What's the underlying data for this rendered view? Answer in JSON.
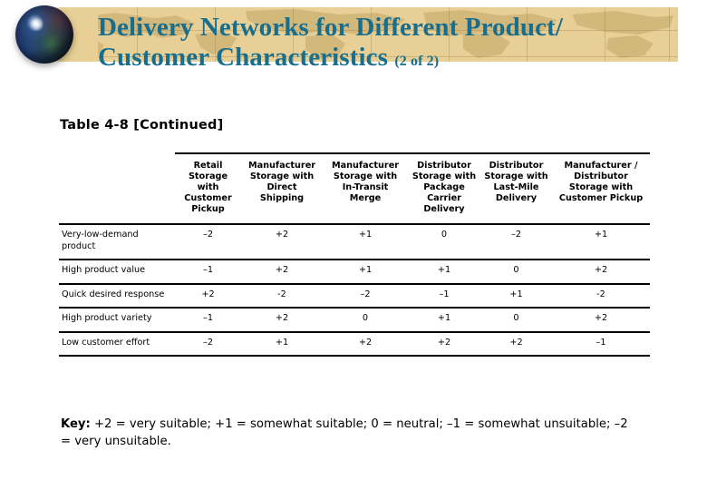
{
  "slide": {
    "title_line1": "Delivery Networks for Different Product/",
    "title_line2": "Customer Characteristics",
    "title_suffix": "(2 of 2)",
    "title_color": "#186e8c",
    "banner_color": "#e8cf95",
    "globe_icon": "globe-icon"
  },
  "table": {
    "caption": "Table 4-8 [Continued]",
    "row_header_blank": "",
    "columns": [
      "Retail Storage with Customer Pickup",
      "Manufacturer Storage with Direct Shipping",
      "Manufacturer Storage with In-Transit Merge",
      "Distributor Storage with Package Carrier Delivery",
      "Distributor Storage with Last-Mile Delivery",
      "Manufacturer / Distributor Storage with Customer Pickup"
    ],
    "rows": [
      {
        "label": "Very-low-demand product",
        "values": [
          "–2",
          "+2",
          "+1",
          "0",
          "–2",
          "+1"
        ]
      },
      {
        "label": "High product value",
        "values": [
          "–1",
          "+2",
          "+1",
          "+1",
          "0",
          "+2"
        ]
      },
      {
        "label": "Quick desired response",
        "values": [
          "+2",
          "-2",
          "–2",
          "–1",
          "+1",
          "-2"
        ]
      },
      {
        "label": "High product variety",
        "values": [
          "–1",
          "+2",
          "0",
          "+1",
          "0",
          "+2"
        ]
      },
      {
        "label": "Low customer effort",
        "values": [
          "–2",
          "+1",
          "+2",
          "+2",
          "+2",
          "–1"
        ]
      }
    ]
  },
  "key": {
    "label": "Key:",
    "text": " +2 = very suitable; +1 = somewhat suitable; 0 = neutral; –1 = somewhat unsuitable; –2 = very unsuitable."
  }
}
